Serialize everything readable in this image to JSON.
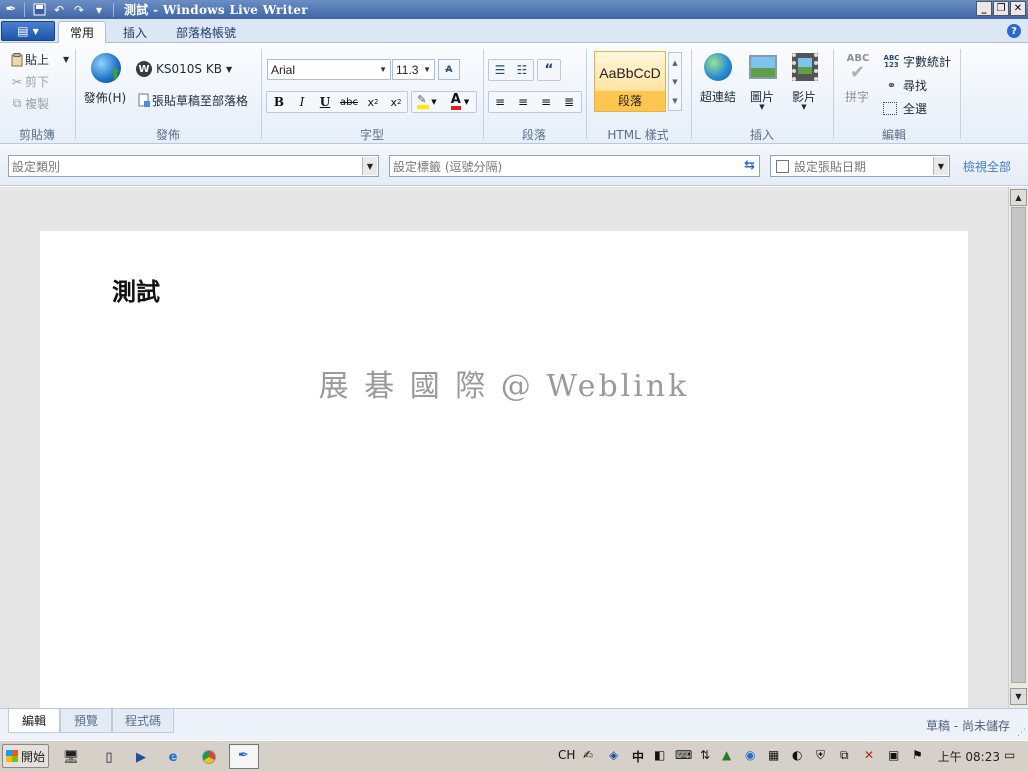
{
  "window": {
    "title": "測試 - Windows Live Writer"
  },
  "tabs": [
    {
      "label": "常用",
      "active": true
    },
    {
      "label": "插入",
      "active": false
    },
    {
      "label": "部落格帳號",
      "active": false
    }
  ],
  "ribbon": {
    "clipboard": {
      "label": "剪貼簿",
      "paste": "貼上",
      "cut": "剪下",
      "copy": "複製"
    },
    "publish": {
      "label": "發佈",
      "publish_btn": "發佈(H)",
      "blog_name": "KS010S KB",
      "paste_draft": "張貼草稿至部落格"
    },
    "font": {
      "label": "字型",
      "font_name": "Arial",
      "font_size": "11.3"
    },
    "paragraph": {
      "label": "段落"
    },
    "styles": {
      "label": "HTML 樣式",
      "sample": "AaBbCcD",
      "style_name": "段落"
    },
    "insert": {
      "label": "插入",
      "hyperlink": "超連結",
      "picture": "圖片",
      "video": "影片"
    },
    "editing": {
      "label": "編輯",
      "spelling": "拼字",
      "word_count": "字數統計",
      "find": "尋找",
      "select_all": "全選"
    }
  },
  "category_bar": {
    "category_placeholder": "設定類別",
    "tags_placeholder": "設定標籤 (逗號分隔)",
    "date_placeholder": "設定張貼日期",
    "view_all": "檢視全部"
  },
  "editor": {
    "post_title": "測試",
    "body_text": "展 碁 國 際 @ Weblink"
  },
  "view_tabs": [
    {
      "label": "編輯",
      "active": true
    },
    {
      "label": "預覽",
      "active": false
    },
    {
      "label": "程式碼",
      "active": false
    }
  ],
  "status_text": "草稿 - 尚未儲存",
  "taskbar": {
    "start_label": "開始",
    "tray_lang": "CH",
    "tray_input": "中",
    "clock": "上午 08:23"
  }
}
